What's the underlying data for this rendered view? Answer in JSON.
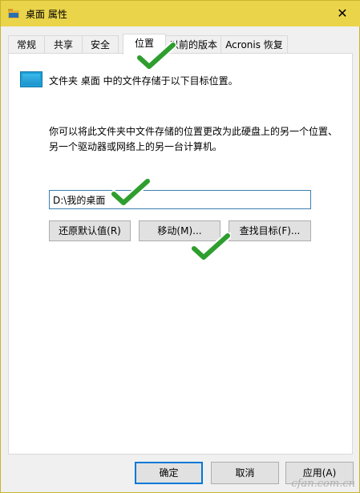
{
  "window": {
    "title": "桌面 属性",
    "close_glyph": "✕"
  },
  "tabs": [
    {
      "label": "常规",
      "active": false
    },
    {
      "label": "共享",
      "active": false
    },
    {
      "label": "安全",
      "active": false
    },
    {
      "label": "位置",
      "active": true
    },
    {
      "label": "以前的版本",
      "active": false
    },
    {
      "label": "Acronis 恢复",
      "active": false
    }
  ],
  "location": {
    "info": "文件夹 桌面 中的文件存储于以下目标位置。",
    "description": "你可以将此文件夹中文件存储的位置更改为此硬盘上的另一个位置、另一个驱动器或网络上的另一台计算机。",
    "path_value": "D:\\我的桌面",
    "restore_default_label": "还原默认值(R)",
    "move_label": "移动(M)...",
    "find_target_label": "查找目标(F)..."
  },
  "footer": {
    "ok_label": "确定",
    "cancel_label": "取消",
    "apply_label": "应用(A)"
  },
  "watermark": "cfan.com.cn",
  "colors": {
    "accent": "#0078d7",
    "titlebar": "#ead44a",
    "check": "#2e9e2e"
  }
}
